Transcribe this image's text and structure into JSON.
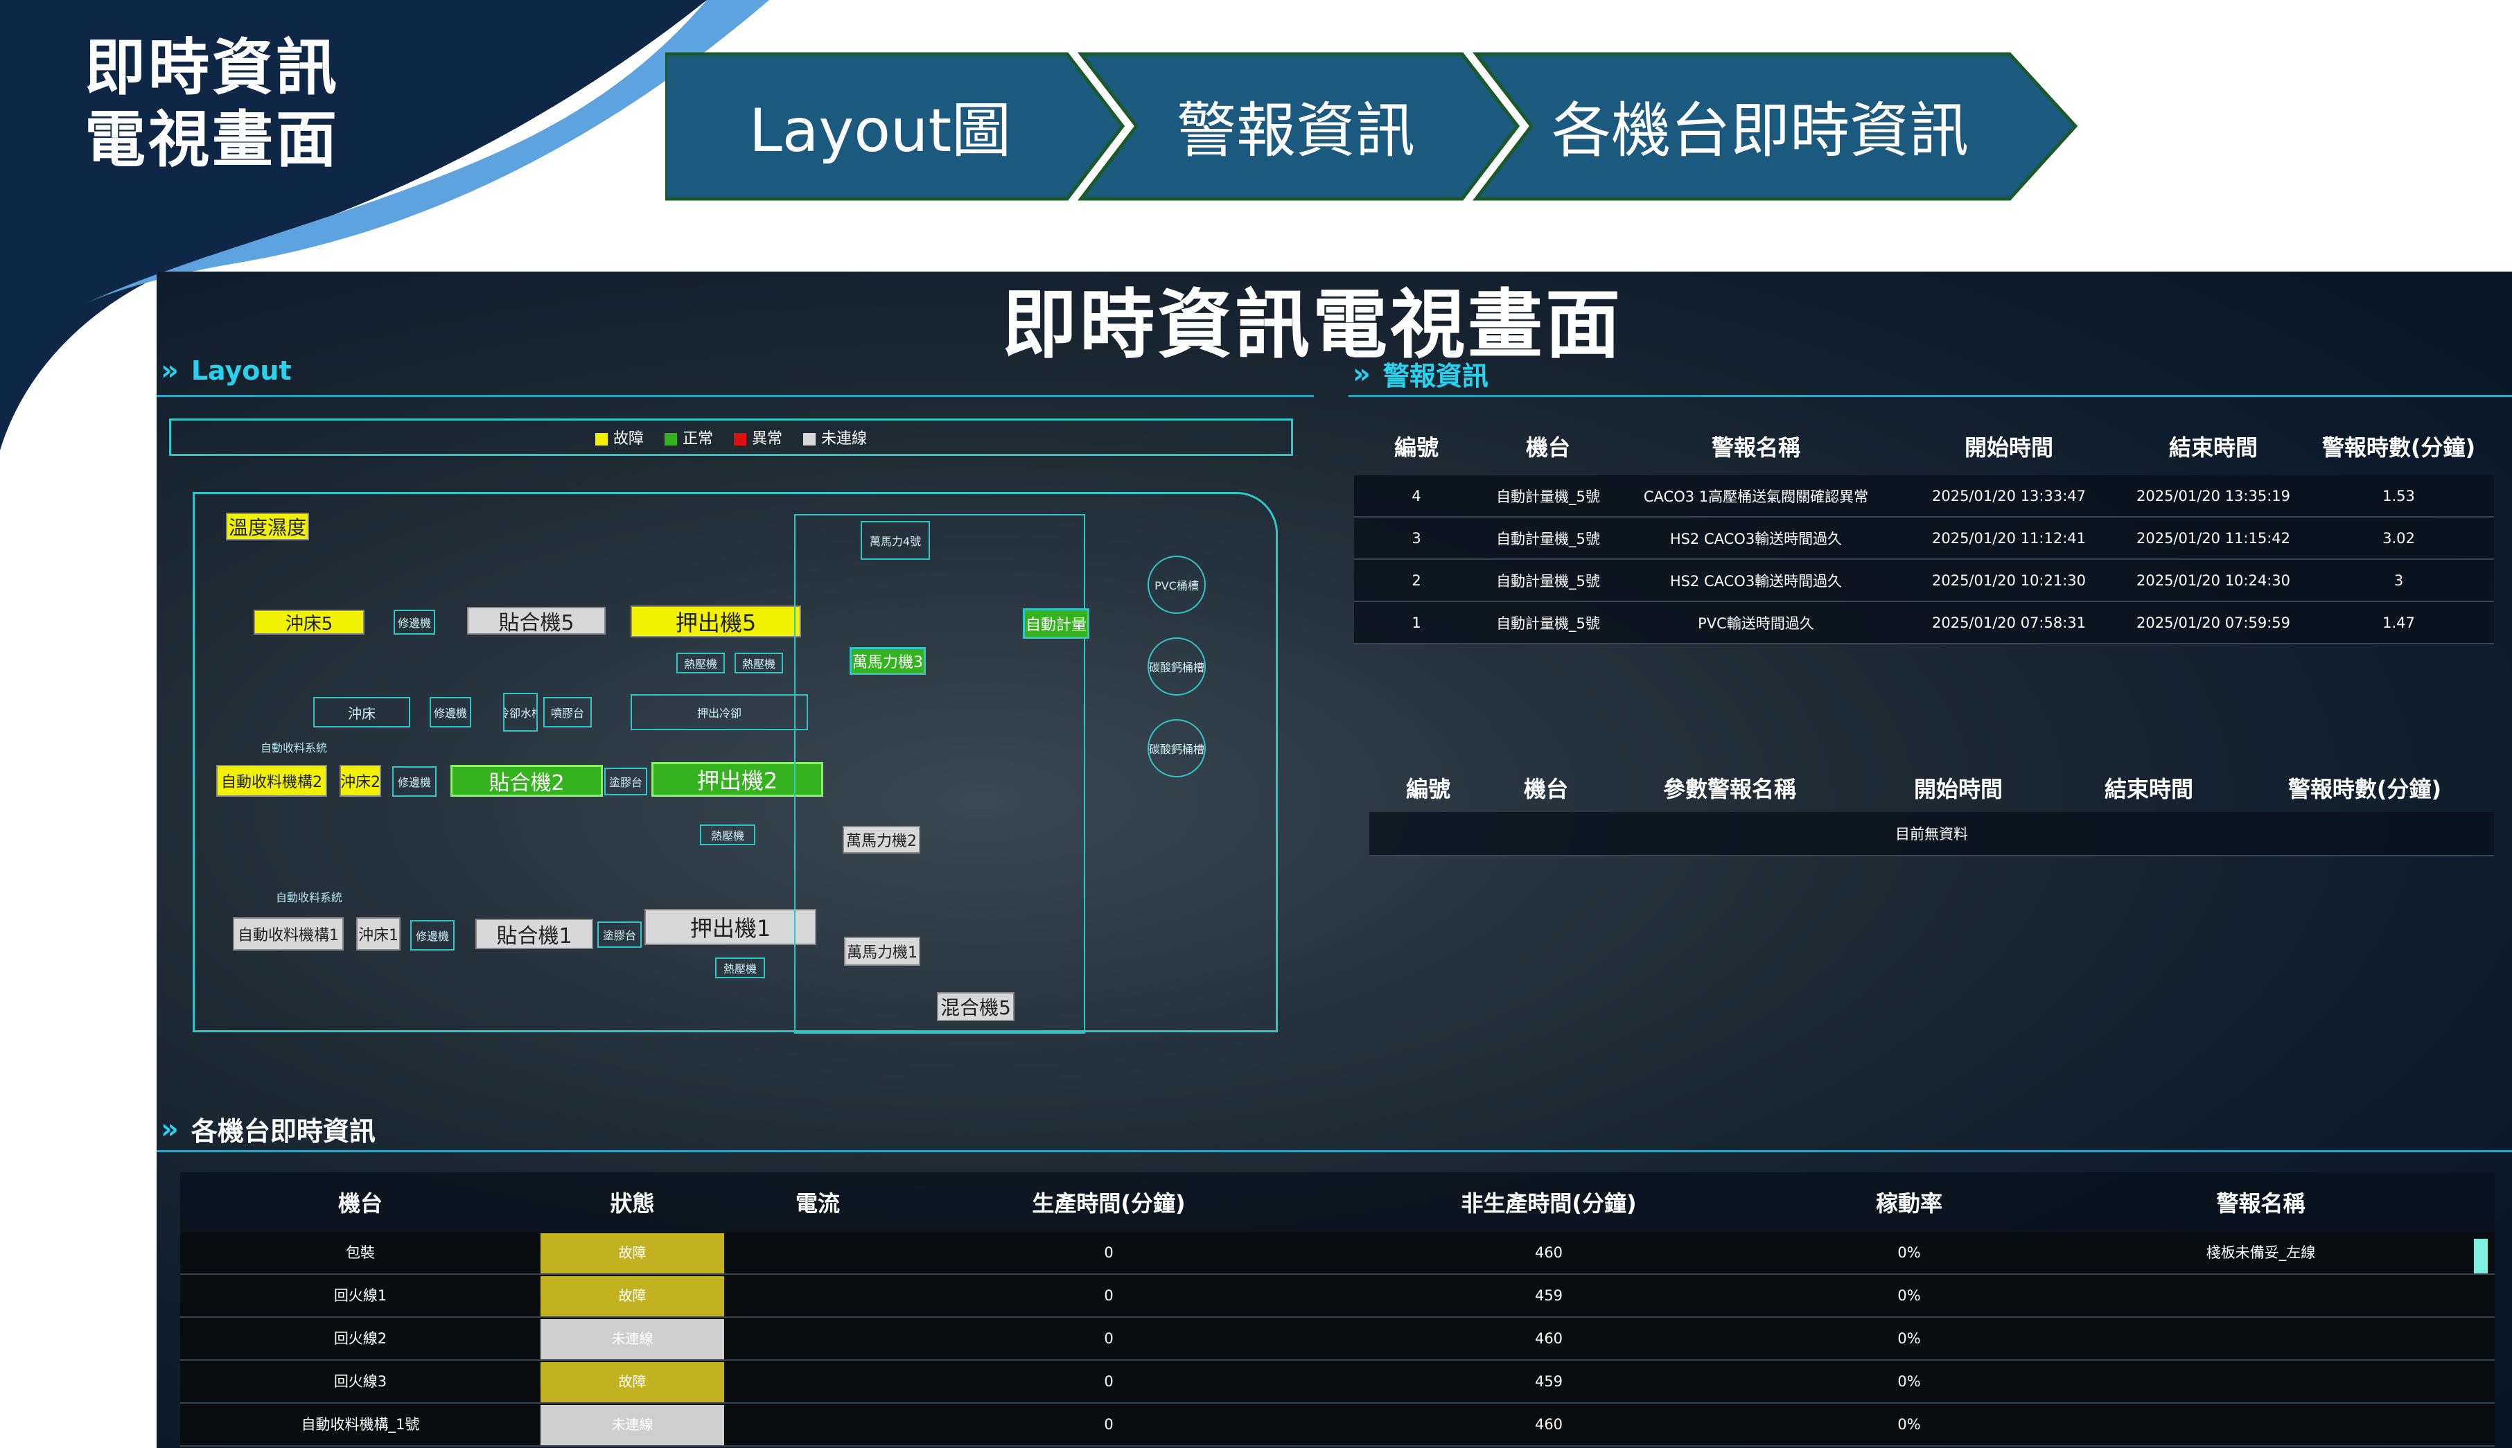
{
  "slide": {
    "title_line1": "即時資訊",
    "title_line2": "電視畫面",
    "nav": [
      "Layout圖",
      "警報資訊",
      "各機台即時資訊"
    ]
  },
  "dashboard": {
    "title": "即時資訊電視畫面",
    "layout_section": {
      "header": "Layout",
      "legend": [
        {
          "label": "故障",
          "color": "#f2f200"
        },
        {
          "label": "正常",
          "color": "#35b31e"
        },
        {
          "label": "異常",
          "color": "#e01010"
        },
        {
          "label": "未連線",
          "color": "#d8d8d8"
        }
      ],
      "machines": {
        "temp_humidity": "溫度濕度",
        "punch5": "沖床5",
        "repair_a": "修邊機",
        "bond5": "貼合機5",
        "extruder5": "押出機5",
        "hot_press_a": "熱壓機",
        "hot_press_b": "熱壓機",
        "punch": "沖床",
        "repair_b": "修邊機",
        "water_cool": "冷卻水槽",
        "spray": "噴膠台",
        "extruder_out": "押出冷卻",
        "auto_collect": "自動收料系統",
        "auto_collect2": "自動收料機構2",
        "punch2": "沖床2",
        "repair_c": "修邊機",
        "bond2": "貼合機2",
        "coat_a": "塗膠台",
        "extruder2": "押出機2",
        "hot_press_c": "熱壓機",
        "auto_collect_sys2": "自動收料系統",
        "auto_collect1": "自動收料機構1",
        "punch1": "沖床1",
        "repair_d": "修邊機",
        "bond1": "貼合機1",
        "coat_b": "塗膠台",
        "extruder1": "押出機1",
        "hot_press_d": "熱壓機",
        "banbury4": "萬馬力4號",
        "banbury3": "萬馬力機3",
        "banbury2": "萬馬力機2",
        "banbury1": "萬馬力機1",
        "auto_meter": "自動計量",
        "mixer5": "混合機5",
        "pvc": "PVC桶槽",
        "calcium": "碳酸鈣桶槽",
        "calcium2": "碳酸鈣桶槽"
      }
    },
    "alarm_section": {
      "header": "警報資訊",
      "columns": [
        "編號",
        "機台",
        "警報名稱",
        "開始時間",
        "結束時間",
        "警報時數(分鐘)"
      ],
      "rows": [
        [
          "4",
          "自動計量機_5號",
          "CACO3 1高壓桶送氣閥關確認異常",
          "2025/01/20 13:33:47",
          "2025/01/20 13:35:19",
          "1.53"
        ],
        [
          "3",
          "自動計量機_5號",
          "HS2 CACO3輸送時間過久",
          "2025/01/20 11:12:41",
          "2025/01/20 11:15:42",
          "3.02"
        ],
        [
          "2",
          "自動計量機_5號",
          "HS2 CACO3輸送時間過久",
          "2025/01/20 10:21:30",
          "2025/01/20 10:24:30",
          "3"
        ],
        [
          "1",
          "自動計量機_5號",
          "PVC輸送時間過久",
          "2025/01/20 07:58:31",
          "2025/01/20 07:59:59",
          "1.47"
        ]
      ],
      "param_columns": [
        "編號",
        "機台",
        "參數警報名稱",
        "開始時間",
        "結束時間",
        "警報時數(分鐘)"
      ],
      "param_empty": "目前無資料"
    },
    "machine_section": {
      "header": "各機台即時資訊",
      "columns": [
        "機台",
        "狀態",
        "電流",
        "生產時間(分鐘)",
        "非生產時間(分鐘)",
        "稼動率",
        "警報名稱"
      ],
      "rows": [
        [
          "包裝",
          "故障",
          "",
          "0",
          "460",
          "0%",
          "棧板未備妥_左線"
        ],
        [
          "回火線1",
          "故障",
          "",
          "0",
          "459",
          "0%",
          ""
        ],
        [
          "回火線2",
          "未連線",
          "",
          "0",
          "460",
          "0%",
          ""
        ],
        [
          "回火線3",
          "故障",
          "",
          "0",
          "459",
          "0%",
          ""
        ],
        [
          "自動收料機構_1號",
          "未連線",
          "",
          "0",
          "460",
          "0%",
          ""
        ]
      ]
    }
  },
  "colors": {
    "navy": "#0f2746",
    "chevron": "#1b5a7e",
    "chevron_border": "#1a5a2a",
    "fault": "#c2b21f",
    "offline": "#cfcfcf",
    "accent": "#25d3ee"
  }
}
